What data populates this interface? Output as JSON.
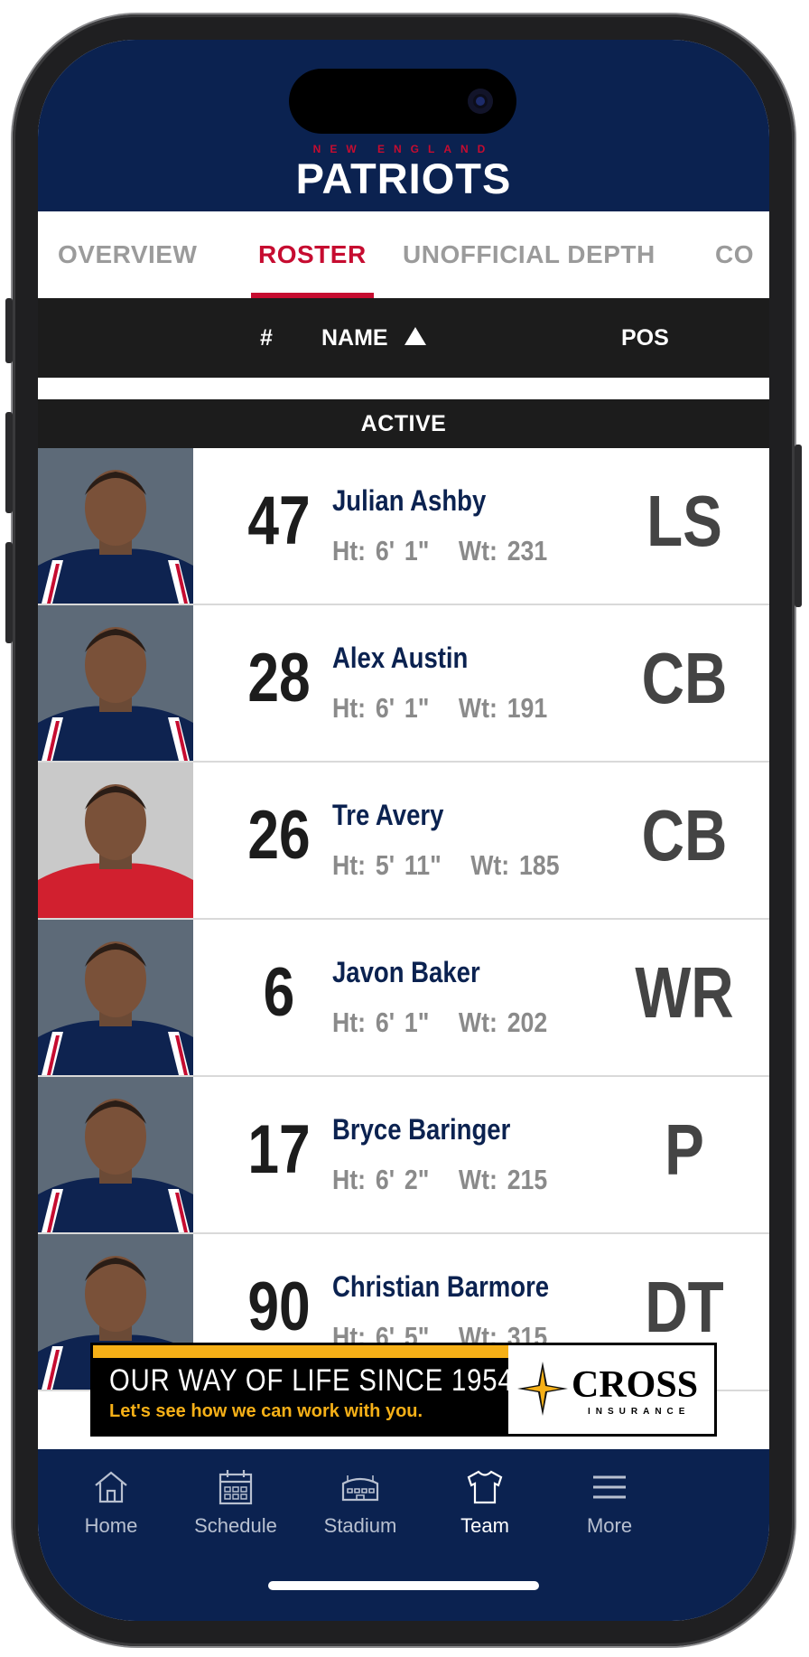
{
  "header": {
    "logo_top": "NEW ENGLAND",
    "logo_main": "PATRIOTS"
  },
  "tabs": [
    {
      "label": "OVERVIEW",
      "active": false
    },
    {
      "label": "ROSTER",
      "active": true
    },
    {
      "label": "UNOFFICIAL DEPTH",
      "active": false
    },
    {
      "label": "CO",
      "active": false
    }
  ],
  "columns": {
    "number": "#",
    "name": "NAME",
    "position": "POS",
    "sort_icon": "triangle-up-icon"
  },
  "section": {
    "label": "ACTIVE"
  },
  "players": [
    {
      "number": "47",
      "name": "Julian Ashby",
      "ht_label": "Ht:",
      "height": "6' 1\"",
      "wt_label": "Wt:",
      "weight": "231",
      "position": "LS",
      "jersey": "navy"
    },
    {
      "number": "28",
      "name": "Alex Austin",
      "ht_label": "Ht:",
      "height": "6' 1\"",
      "wt_label": "Wt:",
      "weight": "191",
      "position": "CB",
      "jersey": "navy"
    },
    {
      "number": "26",
      "name": "Tre Avery",
      "ht_label": "Ht:",
      "height": "5' 11\"",
      "wt_label": "Wt:",
      "weight": "185",
      "position": "CB",
      "jersey": "red"
    },
    {
      "number": "6",
      "name": "Javon Baker",
      "ht_label": "Ht:",
      "height": "6' 1\"",
      "wt_label": "Wt:",
      "weight": "202",
      "position": "WR",
      "jersey": "navy"
    },
    {
      "number": "17",
      "name": "Bryce Baringer",
      "ht_label": "Ht:",
      "height": "6' 2\"",
      "wt_label": "Wt:",
      "weight": "215",
      "position": "P",
      "jersey": "navy"
    },
    {
      "number": "90",
      "name": "Christian Barmore",
      "ht_label": "Ht:",
      "height": "6' 5\"",
      "wt_label": "Wt:",
      "weight": "315",
      "position": "DT",
      "jersey": "navy"
    }
  ],
  "ad": {
    "line1": "OUR WAY OF LIFE SINCE 1954",
    "line2": "Let's see how we can work with you.",
    "brand": "CROSS",
    "brand_sub": "INSURANCE"
  },
  "tabbar": [
    {
      "label": "Home",
      "icon": "home-icon",
      "active": false
    },
    {
      "label": "Schedule",
      "icon": "calendar-icon",
      "active": false
    },
    {
      "label": "Stadium",
      "icon": "stadium-icon",
      "active": false
    },
    {
      "label": "Team",
      "icon": "jersey-icon",
      "active": true
    },
    {
      "label": "More",
      "icon": "menu-icon",
      "active": false
    }
  ],
  "colors": {
    "navy": "#0b2250",
    "red": "#c60c30",
    "dark": "#1c1c1c",
    "ad_yellow": "#f6b017"
  }
}
